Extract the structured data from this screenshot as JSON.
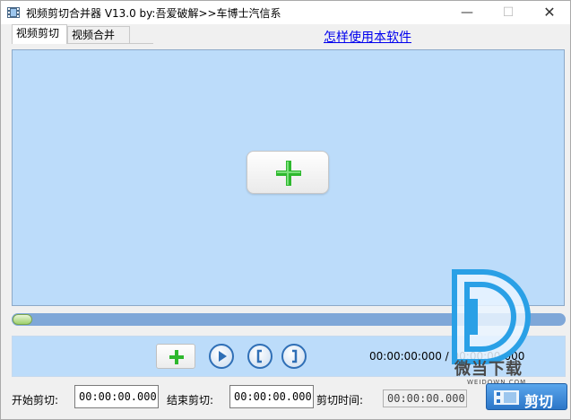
{
  "window": {
    "title": "视频剪切合并器 V13.0 by:吾爱破解>>车博士汽信系",
    "icon": "film-icon",
    "controls": {
      "minimize": "—",
      "maximize": "☐",
      "close": "✕"
    }
  },
  "tabs": [
    {
      "label": "视频剪切",
      "active": true
    },
    {
      "label": "视频合并",
      "active": false
    }
  ],
  "help_link": "怎样使用本软件",
  "video_area": {
    "add_icon": "plus-icon"
  },
  "timeline": {
    "progress": 0.0
  },
  "controls": {
    "add_icon": "plus-icon",
    "play_icon": "play-icon",
    "mark_in_icon": "bracket-left-icon",
    "mark_out_icon": "bracket-right-icon",
    "time_readout": "00:00:00:000 / 00:00:00:000"
  },
  "bottom": {
    "start_label": "开始剪切:",
    "start_value": "00:00:00.000",
    "end_label": "结束剪切:",
    "end_value": "00:00:00.000",
    "duration_label": "剪切时间:",
    "duration_value": "00:00:00.000",
    "cut_button": "剪切"
  },
  "watermark": {
    "text": "微当下载",
    "url": "WEIDOWN.COM"
  },
  "colors": {
    "panel_bg": "#bcdcfa",
    "track": "#7fa7d8",
    "accent_green": "#2eb82e",
    "button_blue": "#2f6fb6"
  }
}
